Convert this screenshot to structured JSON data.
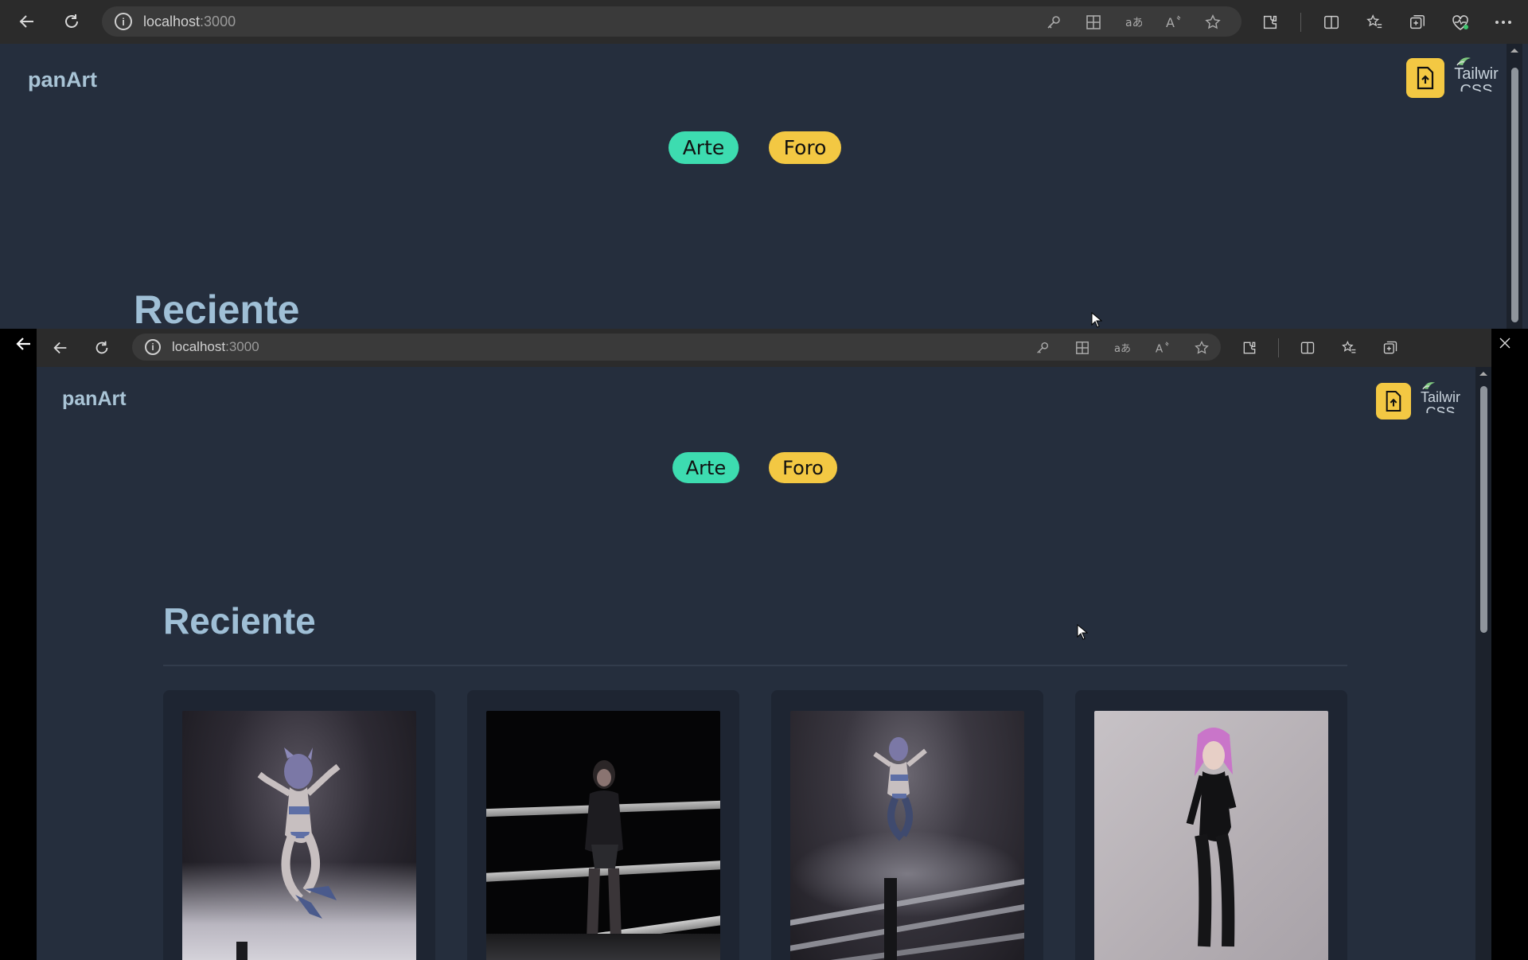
{
  "browser_top": {
    "url_host": "localhost",
    "url_port": ":3000"
  },
  "browser_bottom": {
    "url_host": "localhost",
    "url_port": ":3000"
  },
  "page": {
    "logo": "panArt",
    "nav": {
      "arte": "Arte",
      "foro": "Foro"
    },
    "tailwind_badge_line1": "Tailwir",
    "tailwind_badge_line2": "CSS",
    "heading": "Reciente"
  },
  "colors": {
    "page_bg": "#252e3d",
    "arte_pill": "#3ddcb0",
    "foro_pill": "#f3c843",
    "upload_button": "#f3c843",
    "heading": "#9fbfd6"
  },
  "icons": [
    "back-icon",
    "refresh-icon",
    "info-icon",
    "key-icon",
    "apps-icon",
    "translate-icon",
    "read-aloud-icon",
    "favorite-star-icon",
    "extensions-icon",
    "split-screen-icon",
    "favorites-icon",
    "collections-icon",
    "heartbeat-icon",
    "more-icon",
    "file-upload-icon",
    "cursor-icon"
  ],
  "gallery": [
    {
      "alt": "3D character jumping in smoke"
    },
    {
      "alt": "3D character in dark boxing ring"
    },
    {
      "alt": "3D character jumping over ring"
    },
    {
      "alt": "3D character with pink hair"
    }
  ]
}
